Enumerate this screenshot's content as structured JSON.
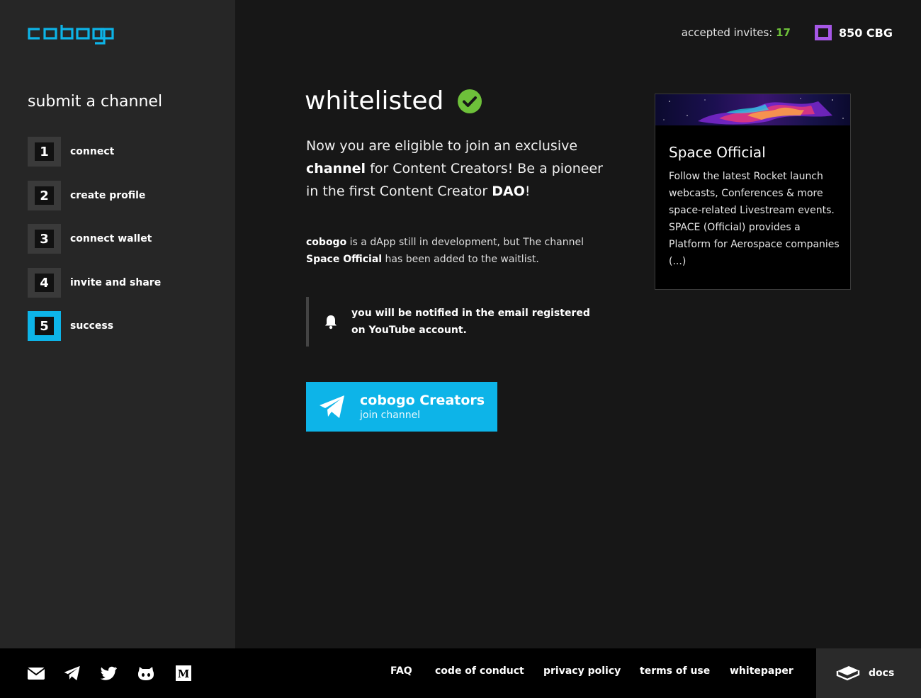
{
  "brand": {
    "logo_text": "cobogo",
    "accent": "#0db4e8"
  },
  "sidebar": {
    "title": "submit a channel",
    "steps": [
      {
        "num": "1",
        "label": "connect"
      },
      {
        "num": "2",
        "label": "create profile"
      },
      {
        "num": "3",
        "label": "connect wallet"
      },
      {
        "num": "4",
        "label": "invite and share"
      },
      {
        "num": "5",
        "label": "success",
        "active": true
      }
    ]
  },
  "topbar": {
    "invites_label": "accepted invites:",
    "invites_count": "17",
    "balance": "850 CBG",
    "balance_icon_color": "#a657e6"
  },
  "main": {
    "status_title": "whitelisted",
    "status_icon": "check-circle-icon",
    "lead": {
      "part1": "Now you are eligible to join an exclusive ",
      "bold1": "channel",
      "part2": " for Content Creators! Be a pioneer in the first Content Creator ",
      "bold2": "DAO",
      "part3": "!"
    },
    "info": {
      "bold1": "cobogo",
      "part1": " is a dApp still in development, but The channel ",
      "bold2": "Space Official",
      "part2": " has been added to the waitlist."
    },
    "notice_text": "you will be notified in the email registered on YouTube account.",
    "join_button": {
      "title": "cobogo Creators",
      "subtitle": "join channel",
      "icon": "telegram-plane-icon"
    }
  },
  "channel_card": {
    "title": "Space Official",
    "description": "Follow the latest Rocket launch webcasts, Conferences & more space-related Livestream events. SPACE (Official) provides a Platform for Aerospace companies (...)"
  },
  "footer": {
    "social": [
      "email-icon",
      "telegram-icon",
      "twitter-icon",
      "github-icon",
      "medium-icon"
    ],
    "links": [
      "FAQ",
      "code of conduct",
      "privacy policy",
      "terms of use",
      "whitepaper"
    ],
    "docs_label": "docs"
  }
}
